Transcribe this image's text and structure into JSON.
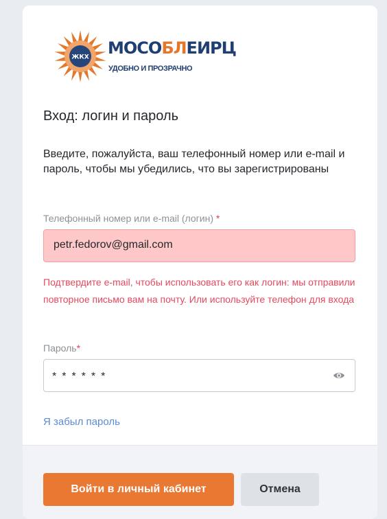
{
  "brand": {
    "name_part1": "МОСО",
    "name_highlight": "БЛ",
    "name_part2": "ЕИРЦ",
    "subtitle": "УДОБНО И ПРОЗРАЧНО",
    "badge": "ЖКХ",
    "color_primary": "#1f3f73",
    "color_accent": "#e3782d"
  },
  "login": {
    "title": "Вход: логин и пароль",
    "description": "Введите, пожалуйста, ваш телефонный номер или e-mail и пароль, чтобы мы убедились, что вы зарегистрированы"
  },
  "login_field": {
    "label": "Телефонный номер или e-mail (логин)",
    "required_mark": "*",
    "value": "petr.fedorov@gmail.com",
    "state": "error",
    "error_message": "Подтвердите e-mail, чтобы использовать его как логин: мы отправили повторное письмо вам на почту. Или используйте телефон для входа"
  },
  "password_field": {
    "label": "Пароль",
    "required_mark": "*",
    "masked_value": "******",
    "toggle_icon": "eye-icon"
  },
  "links": {
    "forgot_password": "Я забыл пароль"
  },
  "actions": {
    "submit_label": "Войти в личный кабинет",
    "cancel_label": "Отмена",
    "submit_color": "#e87832"
  }
}
